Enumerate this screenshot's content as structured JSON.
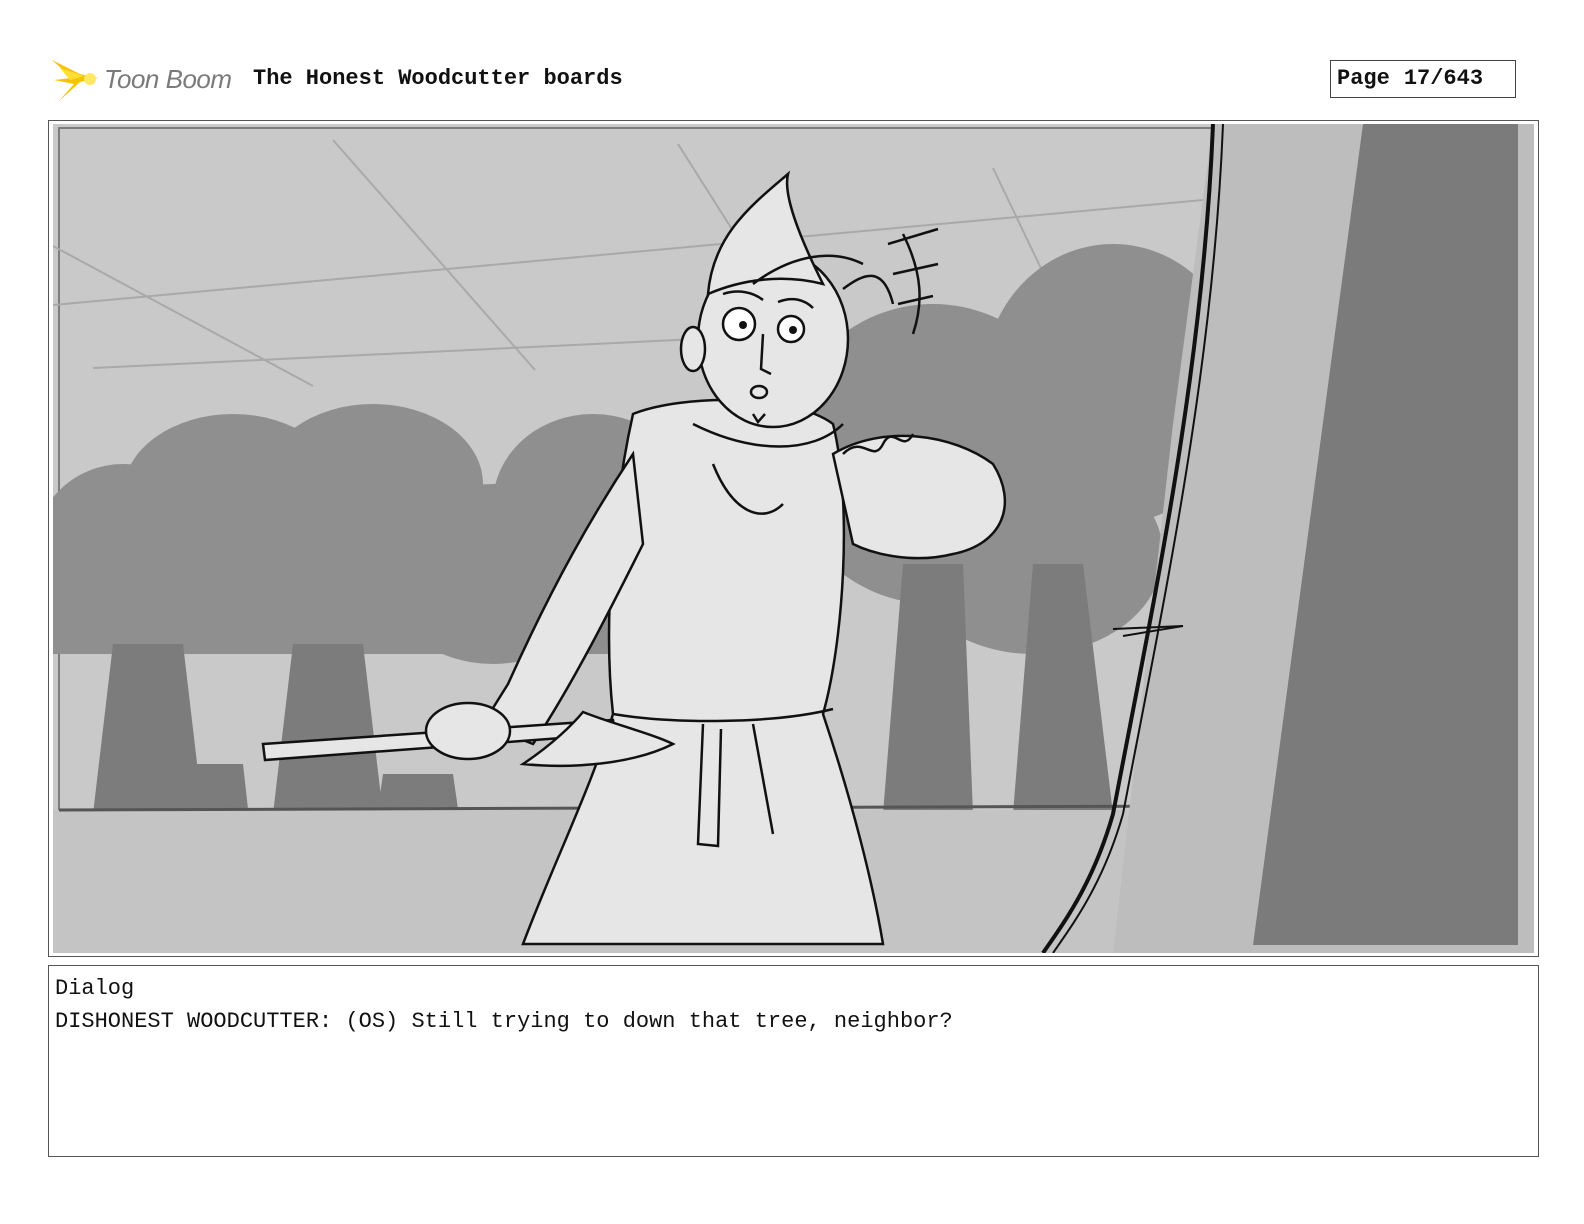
{
  "header": {
    "logo_text": "Toon Boom",
    "logo_accent": "#f5c400",
    "board_title": "The Honest Woodcutter boards",
    "page_label": "Page",
    "page_number": "17/643"
  },
  "panel": {
    "image_icon": "storyboard-sketch-woodcutter-with-axe",
    "colors": {
      "sky": "#c8c8c8",
      "trees": "#8c8c8c",
      "tree_trunk": "#7a7a7a",
      "figure": "#e6e6e6",
      "foreground_trunk": "#7b7b7b"
    }
  },
  "dialog": {
    "heading": "Dialog",
    "line": "DISHONEST WOODCUTTER: (OS) Still trying to down that tree, neighbor?"
  }
}
